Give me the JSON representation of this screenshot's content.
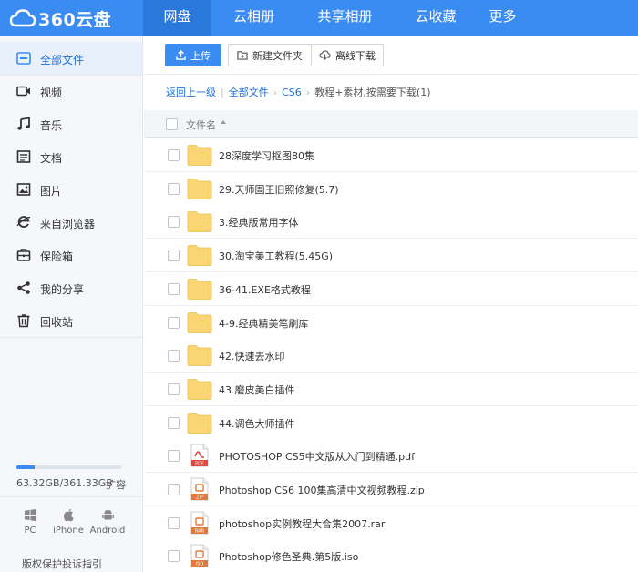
{
  "app": {
    "logo_text": "360云盘"
  },
  "nav": {
    "items": [
      {
        "label": "网盘",
        "active": true
      },
      {
        "label": "云相册"
      },
      {
        "label": "共享相册"
      },
      {
        "label": "云收藏"
      },
      {
        "label": "更多"
      }
    ]
  },
  "sidebar": {
    "items": [
      {
        "label": "全部文件",
        "icon": "all-files-icon",
        "active": true
      },
      {
        "label": "视频",
        "icon": "video-icon"
      },
      {
        "label": "音乐",
        "icon": "music-icon"
      },
      {
        "label": "文档",
        "icon": "document-icon"
      },
      {
        "label": "图片",
        "icon": "image-icon"
      },
      {
        "label": "来自浏览器",
        "icon": "browser-icon"
      },
      {
        "label": "保险箱",
        "icon": "safe-icon"
      },
      {
        "label": "我的分享",
        "icon": "share-icon"
      },
      {
        "label": "回收站",
        "icon": "trash-icon"
      }
    ],
    "storage": {
      "used": "63.32GB",
      "total": "361.33GB",
      "text": "63.32GB/361.33GB",
      "fraction": 0.175
    },
    "expand_label": "扩容",
    "clients": [
      {
        "label": "PC",
        "icon": "windows-icon"
      },
      {
        "label": "iPhone",
        "icon": "apple-icon"
      },
      {
        "label": "Android",
        "icon": "android-icon"
      }
    ],
    "report_link": "版权保护投诉指引"
  },
  "toolbar": {
    "upload_label": "上传",
    "new_folder_label": "新建文件夹",
    "offline_download_label": "离线下载"
  },
  "breadcrumb": {
    "back": "返回上一级",
    "items": [
      "全部文件",
      "CS6"
    ],
    "current": "教程+素材,按需要下载(1)"
  },
  "list": {
    "header_name": "文件名",
    "files": [
      {
        "name": "28深度学习抠图80集",
        "type": "folder"
      },
      {
        "name": "29.天师圄王旧照修复(5.7)",
        "type": "folder"
      },
      {
        "name": "3.经典版常用字体",
        "type": "folder"
      },
      {
        "name": "30.淘宝美工教程(5.45G)",
        "type": "folder"
      },
      {
        "name": "36-41.EXE格式教程",
        "type": "folder"
      },
      {
        "name": "4-9.经典精美笔刷库",
        "type": "folder"
      },
      {
        "name": "42.快速去水印",
        "type": "folder"
      },
      {
        "name": "43.磨皮美白插件",
        "type": "folder"
      },
      {
        "name": "44.调色大师插件",
        "type": "folder"
      },
      {
        "name": "PHOTOSHOP CS5中文版从入门到精通.pdf",
        "type": "pdf",
        "badge": "PDF"
      },
      {
        "name": "Photoshop CS6 100集高清中文视频教程.zip",
        "type": "zip",
        "badge": "ZIP"
      },
      {
        "name": "photoshop实例教程大合集2007.rar",
        "type": "rar",
        "badge": "RAR"
      },
      {
        "name": "Photoshop修色圣典.第5版.iso",
        "type": "iso",
        "badge": "ISO"
      }
    ]
  },
  "colors": {
    "brand": "#3b8cf2",
    "brand_dark": "#2a78dc",
    "folder": "#f9d573",
    "pdf": "#e0473e",
    "archive": "#e07a3a"
  }
}
